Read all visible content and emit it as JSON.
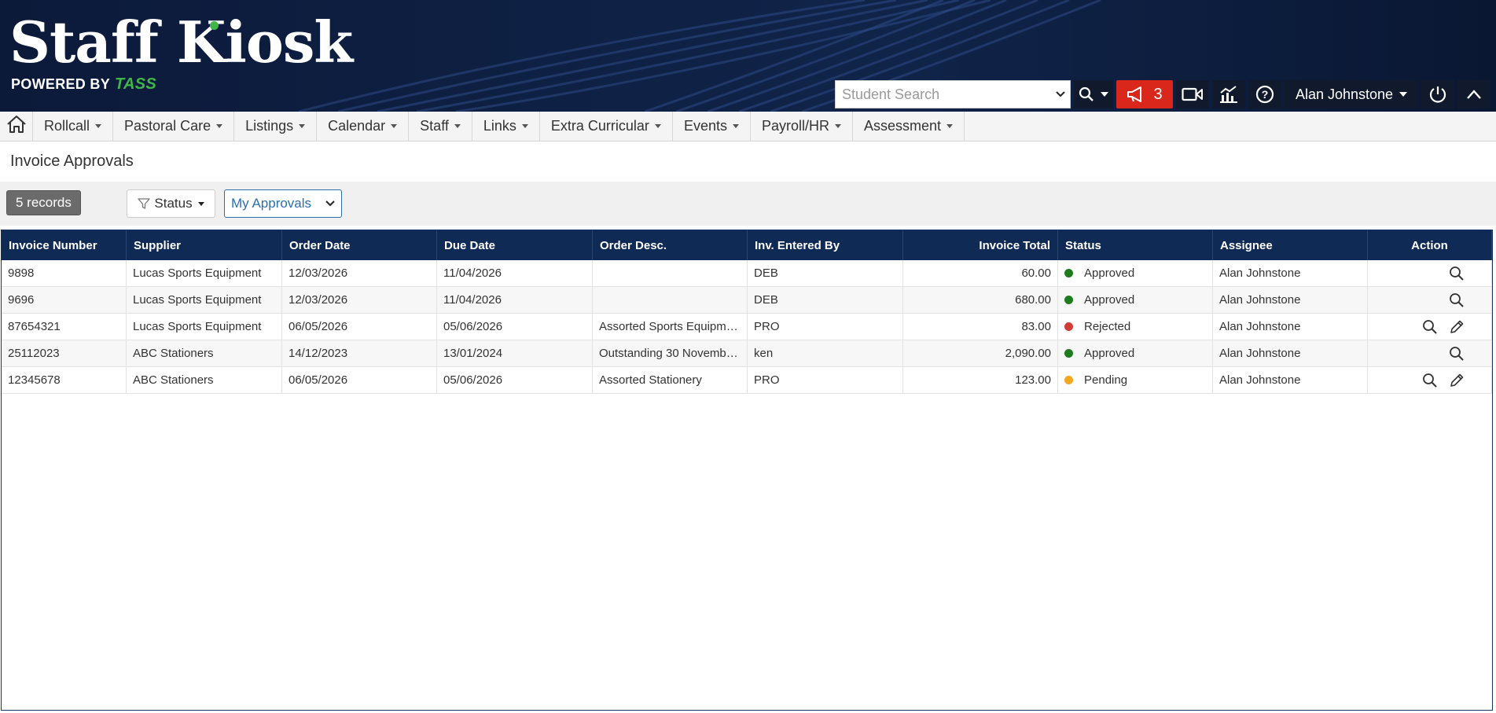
{
  "app": {
    "name": "Staff Kiosk",
    "powered_by": "POWERED BY",
    "powered_brand": "TASS"
  },
  "header": {
    "search_placeholder": "Student Search",
    "notifications_count": "3",
    "user_name": "Alan Johnstone",
    "icons": [
      "search-icon",
      "megaphone-icon",
      "video-icon",
      "analytics-icon",
      "help-icon",
      "power-icon",
      "chevron-up-icon"
    ],
    "colors": {
      "header_bg": "#0d1c3d",
      "alert_bg": "#d9271c",
      "brand_green": "#3fb54a"
    }
  },
  "nav": {
    "items": [
      {
        "label": "Rollcall"
      },
      {
        "label": "Pastoral Care"
      },
      {
        "label": "Listings"
      },
      {
        "label": "Calendar"
      },
      {
        "label": "Staff"
      },
      {
        "label": "Links"
      },
      {
        "label": "Extra Curricular"
      },
      {
        "label": "Events"
      },
      {
        "label": "Payroll/HR"
      },
      {
        "label": "Assessment"
      }
    ]
  },
  "page": {
    "title": "Invoice Approvals",
    "records": "5 records",
    "status_filter": "Status",
    "approvals_select": "My Approvals"
  },
  "table": {
    "columns": [
      "Invoice Number",
      "Supplier",
      "Order Date",
      "Due Date",
      "Order Desc.",
      "Inv. Entered By",
      "Invoice Total",
      "Status",
      "Assignee",
      "Action"
    ],
    "rows": [
      {
        "invoice": "9898",
        "supplier": "Lucas Sports Equipment",
        "order_date": "12/03/2026",
        "due_date": "11/04/2026",
        "desc": "",
        "entered_by": "DEB",
        "total": "60.00",
        "status": "Approved",
        "status_color": "#1e7b1e",
        "assignee": "Alan Johnstone",
        "editable": false
      },
      {
        "invoice": "9696",
        "supplier": "Lucas Sports Equipment",
        "order_date": "12/03/2026",
        "due_date": "11/04/2026",
        "desc": "",
        "entered_by": "DEB",
        "total": "680.00",
        "status": "Approved",
        "status_color": "#1e7b1e",
        "assignee": "Alan Johnstone",
        "editable": false
      },
      {
        "invoice": "87654321",
        "supplier": "Lucas Sports Equipment",
        "order_date": "06/05/2026",
        "due_date": "05/06/2026",
        "desc": "Assorted Sports Equipment",
        "entered_by": "PRO",
        "total": "83.00",
        "status": "Rejected",
        "status_color": "#d23c36",
        "assignee": "Alan Johnstone",
        "editable": true
      },
      {
        "invoice": "25112023",
        "supplier": "ABC Stationers",
        "order_date": "14/12/2023",
        "due_date": "13/01/2024",
        "desc": "Outstanding 30 Novemb…",
        "entered_by": "ken",
        "total": "2,090.00",
        "status": "Approved",
        "status_color": "#1e7b1e",
        "assignee": "Alan Johnstone",
        "editable": false
      },
      {
        "invoice": "12345678",
        "supplier": "ABC Stationers",
        "order_date": "06/05/2026",
        "due_date": "05/06/2026",
        "desc": "Assorted Stationery",
        "entered_by": "PRO",
        "total": "123.00",
        "status": "Pending",
        "status_color": "#f3a81d",
        "assignee": "Alan Johnstone",
        "editable": true
      }
    ]
  }
}
